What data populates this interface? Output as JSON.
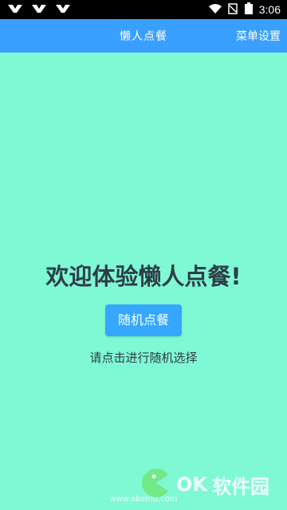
{
  "status_bar": {
    "time": "3:06",
    "battery": "2"
  },
  "app_bar": {
    "title": "懒人点餐",
    "menu_settings": "菜单设置"
  },
  "main": {
    "welcome": "欢迎体验懒人点餐!",
    "random_button": "随机点餐",
    "hint": "请点击进行随机选择"
  },
  "watermark": {
    "brand": "OK",
    "suffix": "软件园",
    "url": "www.okemu.com"
  },
  "colors": {
    "app_bar": "#3aa0ff",
    "background": "#7ff9d3",
    "button": "#35a7ff",
    "text": "#2e3e49"
  }
}
